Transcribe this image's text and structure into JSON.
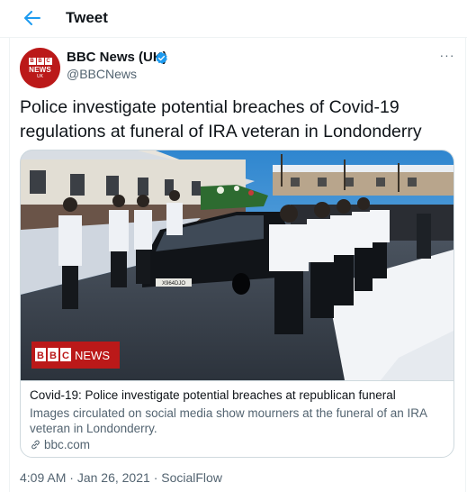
{
  "header": {
    "back_icon": "arrow-left-icon",
    "title": "Tweet"
  },
  "author": {
    "avatar_text_news": "NEWS",
    "avatar_text_uk": "UK",
    "avatar_blocks": [
      "B",
      "B",
      "C"
    ],
    "display_name": "BBC News (UK)",
    "verified_icon": "verified-badge-icon",
    "handle": "@BBCNews",
    "more_icon": "more-horizontal-icon",
    "more_label": "···"
  },
  "tweet": {
    "text": "Police investigate potential breaches of Covid-19 regulations at funeral of IRA veteran in Londonderry"
  },
  "card": {
    "image_watermark_bbc": [
      "B",
      "B",
      "C"
    ],
    "image_watermark_news": "NEWS",
    "plate_text": "X964DJO",
    "title": "Covid-19: Police investigate potential breaches at republican funeral",
    "description": "Images circulated on social media show mourners at the funeral of an IRA veteran in Londonderry.",
    "link_icon": "link-icon",
    "domain": "bbc.com"
  },
  "meta": {
    "time": "4:09 AM",
    "separator": "·",
    "date": "Jan 26, 2021",
    "source": "SocialFlow"
  },
  "colors": {
    "accent": "#1d9bf0",
    "bbc_red": "#bb1919",
    "secondary_text": "#536471",
    "border": "#cfd9de"
  }
}
